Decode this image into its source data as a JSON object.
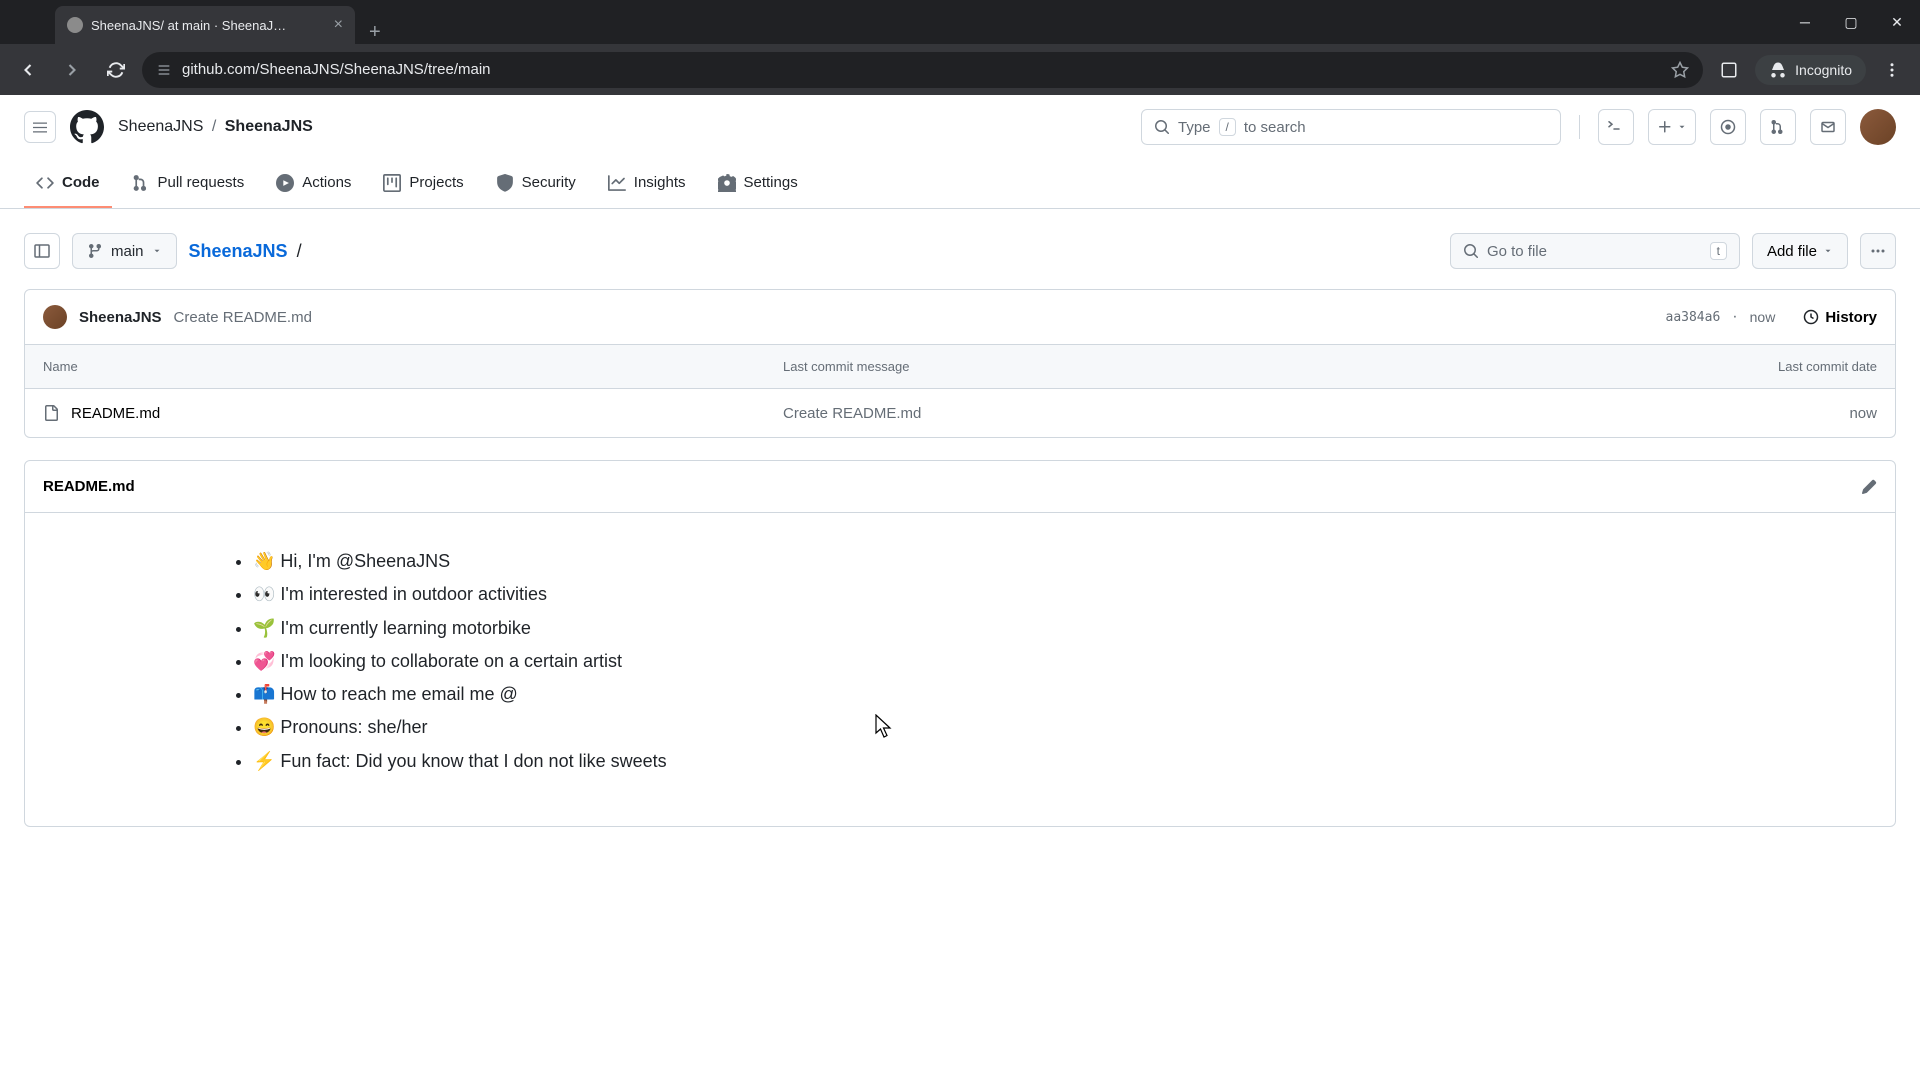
{
  "browser": {
    "tab_title": "SheenaJNS/ at main · SheenaJ…",
    "url": "github.com/SheenaJNS/SheenaJNS/tree/main",
    "incognito_label": "Incognito"
  },
  "header": {
    "owner": "SheenaJNS",
    "repo": "SheenaJNS",
    "search_placeholder_pre": "Type ",
    "search_kbd": "/",
    "search_placeholder_post": " to search"
  },
  "nav": {
    "code": "Code",
    "pull_requests": "Pull requests",
    "actions": "Actions",
    "projects": "Projects",
    "security": "Security",
    "insights": "Insights",
    "settings": "Settings"
  },
  "toolbar": {
    "branch": "main",
    "repo_link": "SheenaJNS",
    "goto_file": "Go to file",
    "goto_kbd": "t",
    "add_file": "Add file"
  },
  "commit": {
    "author": "SheenaJNS",
    "message": "Create README.md",
    "sha": "aa384a6",
    "time": "now",
    "history": "History"
  },
  "table": {
    "col_name": "Name",
    "col_msg": "Last commit message",
    "col_date": "Last commit date",
    "rows": [
      {
        "name": "README.md",
        "msg": "Create README.md",
        "date": "now"
      }
    ]
  },
  "readme": {
    "filename": "README.md",
    "items": [
      "👋 Hi, I'm @SheenaJNS",
      "👀 I'm interested in outdoor activities",
      "🌱 I'm currently learning motorbike",
      "💞️ I'm looking to collaborate on a certain artist",
      "📫 How to reach me email me @",
      "😄 Pronouns: she/her",
      "⚡ Fun fact: Did you know that I don not like sweets"
    ]
  }
}
